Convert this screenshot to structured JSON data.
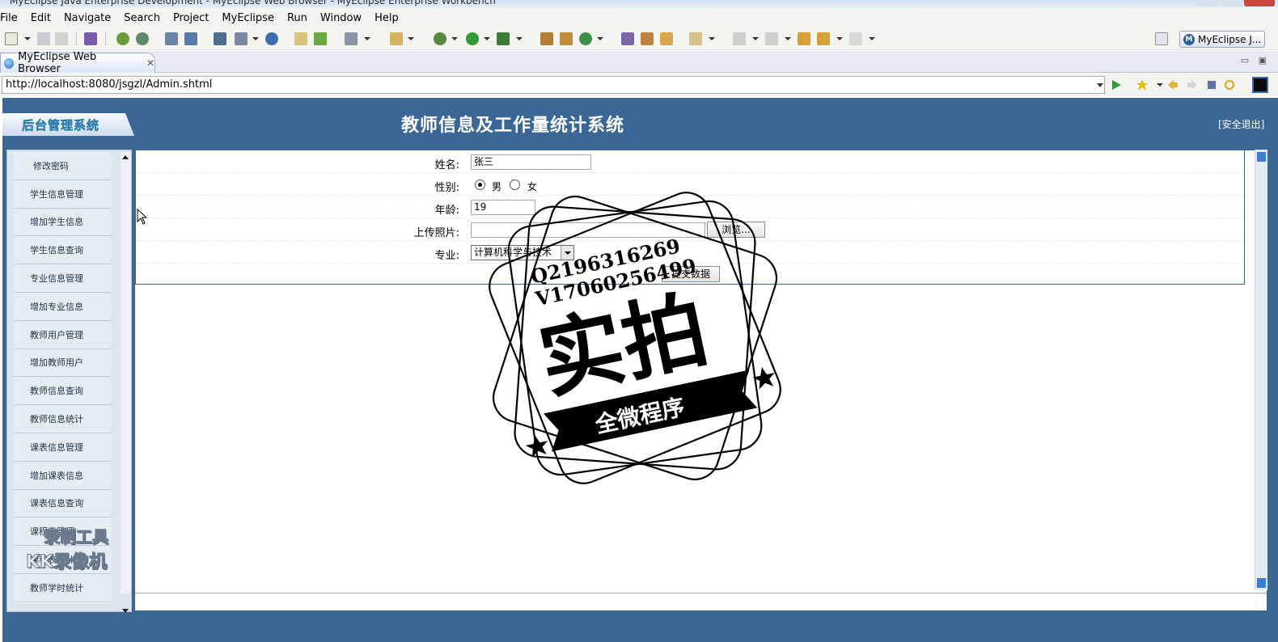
{
  "window": {
    "title": "MyEclipse Java Enterprise Development - MyEclipse Web Browser - MyEclipse Enterprise Workbench"
  },
  "menubar": [
    "File",
    "Edit",
    "Navigate",
    "Search",
    "Project",
    "MyEclipse",
    "Run",
    "Window",
    "Help"
  ],
  "toolbar": {
    "perspective_label": "MyEclipse J..."
  },
  "editor_tab": {
    "label": "MyEclipse Web Browser"
  },
  "browser": {
    "url": "http://localhost:8080/jsgzl/Admin.shtml"
  },
  "site": {
    "logo_text": "后台管理系统",
    "title": "教师信息及工作量统计系统",
    "logout": "[安全退出]"
  },
  "sidebar": {
    "items": [
      "修改密码",
      "学生信息管理",
      "增加学生信息",
      "学生信息查询",
      "专业信息管理",
      "增加专业信息",
      "教师用户管理",
      "增加教师用户",
      "教师信息查询",
      "教师信息统计",
      "课表信息管理",
      "增加课表信息",
      "课表信息查询",
      "课程表管理",
      "课程表统计",
      "教师学时统计"
    ]
  },
  "form": {
    "name_label": "姓名:",
    "name_value": "张三",
    "gender_label": "性别:",
    "gender_male": "男",
    "gender_female": "女",
    "age_label": "年龄:",
    "age_value": "19",
    "photo_label": "上传照片:",
    "browse_button": "浏览...",
    "major_label": "专业:",
    "major_value": "计算机科学与技术",
    "submit_button": "提交数据"
  },
  "watermark": {
    "line1": "Q2196316269",
    "line2": "V17060256499",
    "big": "实拍",
    "banner": "全微程序"
  },
  "recorder_overlay": {
    "line1": "录制工具",
    "line2": "KK录像机"
  }
}
